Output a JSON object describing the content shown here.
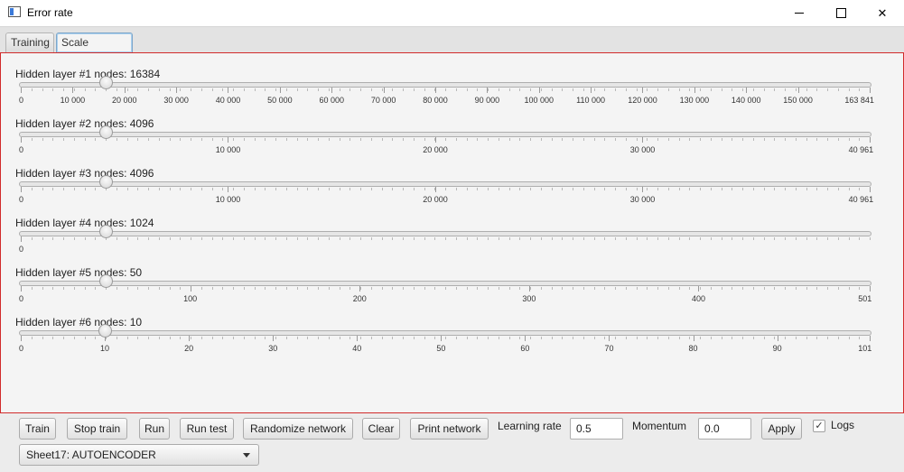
{
  "window": {
    "title": "Error rate"
  },
  "tabs": [
    {
      "label": "Training"
    },
    {
      "label": "Scale network",
      "selected": true
    }
  ],
  "sliders": [
    {
      "label": "Hidden layer #1 nodes: 16384",
      "min": 0,
      "max": 163841,
      "value": 16384,
      "ticks": [
        0,
        10000,
        20000,
        30000,
        40000,
        50000,
        60000,
        70000,
        80000,
        90000,
        100000,
        110000,
        120000,
        130000,
        140000,
        150000,
        163841
      ],
      "tick_labels": [
        "0",
        "10 000",
        "20 000",
        "30 000",
        "40 000",
        "50 000",
        "60 000",
        "70 000",
        "80 000",
        "90 000",
        "100 000",
        "110 000",
        "120 000",
        "130 000",
        "140 000",
        "150 000",
        "163 841"
      ]
    },
    {
      "label": "Hidden layer #2 nodes: 4096",
      "min": 0,
      "max": 40961,
      "value": 4096,
      "ticks": [
        0,
        10000,
        20000,
        30000,
        40961
      ],
      "tick_labels": [
        "0",
        "10 000",
        "20 000",
        "30 000",
        "40 961"
      ]
    },
    {
      "label": "Hidden layer #3 nodes: 4096",
      "min": 0,
      "max": 40961,
      "value": 4096,
      "ticks": [
        0,
        10000,
        20000,
        30000,
        40961
      ],
      "tick_labels": [
        "0",
        "10 000",
        "20 000",
        "30 000",
        "40 961"
      ]
    },
    {
      "label": "Hidden layer #4 nodes: 1024",
      "min": 0,
      "max": 10241,
      "value": 1024,
      "ticks": [
        0
      ],
      "tick_labels": [
        "0"
      ]
    },
    {
      "label": "Hidden layer #5 nodes: 50",
      "min": 0,
      "max": 501,
      "value": 50,
      "ticks": [
        0,
        100,
        200,
        300,
        400,
        501
      ],
      "tick_labels": [
        "0",
        "100",
        "200",
        "300",
        "400",
        "501"
      ]
    },
    {
      "label": "Hidden layer #6 nodes: 10",
      "min": 0,
      "max": 101,
      "value": 10,
      "ticks": [
        0,
        10,
        20,
        30,
        40,
        50,
        60,
        70,
        80,
        90,
        101
      ],
      "tick_labels": [
        "0",
        "10",
        "20",
        "30",
        "40",
        "50",
        "60",
        "70",
        "80",
        "90",
        "101"
      ]
    }
  ],
  "toolbar": {
    "train": "Train",
    "stop_train": "Stop train",
    "run": "Run",
    "run_test": "Run test",
    "randomize": "Randomize network",
    "clear": "Clear",
    "print": "Print network",
    "learning_rate_label": "Learning rate",
    "learning_rate_value": "0.5",
    "momentum_label": "Momentum",
    "momentum_value": "0.0",
    "apply": "Apply",
    "logs_label": "Logs",
    "logs_checked": true,
    "logs_check_glyph": "✓",
    "sheet_selected": "Sheet17: AUTOENCODER"
  },
  "icons": {
    "min_glyph": "",
    "close_glyph": "✕"
  },
  "colors": {
    "content_border": "#d12b2b",
    "tab_focus": "#7ea6c9"
  }
}
